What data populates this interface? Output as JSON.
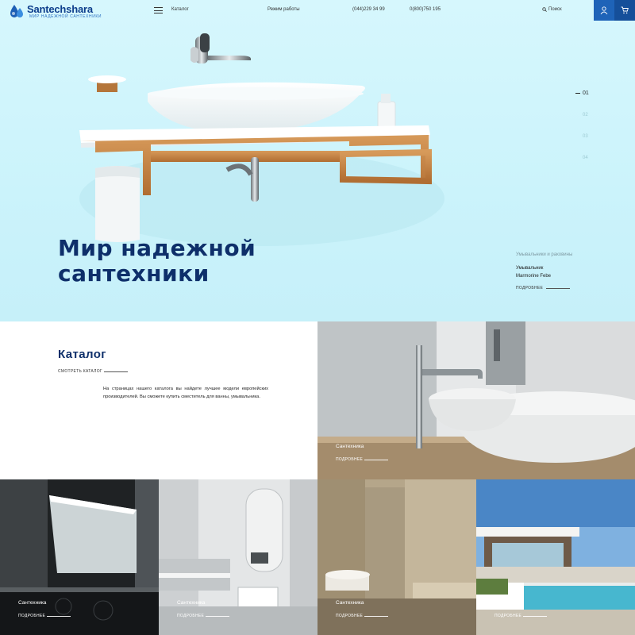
{
  "header": {
    "logo_name": "Santechshara",
    "logo_tagline": "МИР НАДЕЖНОЙ САНТЕХНИКИ",
    "nav_catalog": "Каталог",
    "nav_hours": "Режим работы",
    "phone_1": "(044)229 34 99",
    "phone_2": "0(800)750 195",
    "search_label": "Поиск",
    "accent": "#1e63b8"
  },
  "hero": {
    "title_line1": "Мир надежной",
    "title_line2": "сантехники",
    "slides": [
      "01",
      "02",
      "03",
      "04"
    ],
    "active_slide": "01",
    "category": "Умывальники и раковины",
    "product_line1": "Умывальник",
    "product_line2": "Marmorine Febe",
    "more_label": "ПОДРОБНЕЕ",
    "background": "#cbf3fb"
  },
  "catalog": {
    "title": "Каталог",
    "view_link": "СМОТРЕТЬ КАТАЛОГ",
    "description": "На страницах нашего каталога вы найдете лучшее модели европейских производителей. Вы сможете купить сместитель для ванны, умывальника."
  },
  "tiles": [
    {
      "label": "Сантехника",
      "more": "ПОДРОБНЕЕ"
    },
    {
      "label": "Сантехника",
      "more": "ПОДРОБНЕЕ"
    },
    {
      "label": "Сантехника",
      "more": "ПОДРОБНЕЕ"
    },
    {
      "label": "Сантехника",
      "more": "ПОДРОБНЕЕ"
    },
    {
      "label": "Сантехника",
      "more": "ПОДРОБНЕЕ"
    }
  ]
}
